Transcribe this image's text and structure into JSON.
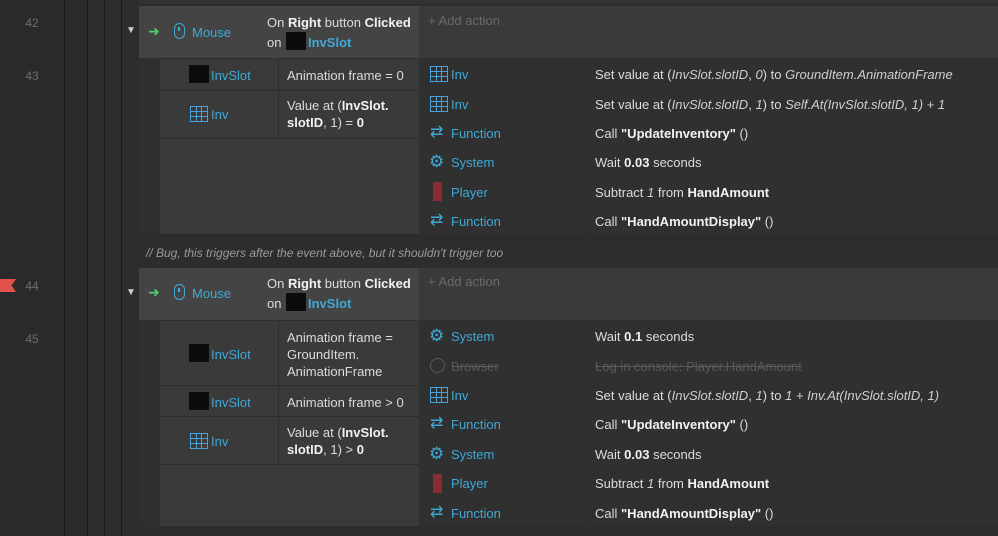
{
  "line_numbers": [
    "42",
    "43",
    "44",
    "45"
  ],
  "add_action": "+ Add action",
  "comment": "//  Bug, this triggers after the event above, but it shouldn't trigger too",
  "event1": {
    "trigger_object": "Mouse",
    "trigger_text": [
      "On ",
      "Right",
      " button ",
      "Clicked"
    ],
    "trigger_on": "on ",
    "trigger_target": "InvSlot",
    "conditions": [
      {
        "object": "InvSlot",
        "text": "Animation frame = 0"
      },
      {
        "object": "Inv",
        "text_plain": "Value at (",
        "text_bold1": "InvSlot.",
        "text_bold2": "slotID",
        "text_tail": ", 1) = ",
        "text_bold3": "0"
      }
    ],
    "actions": [
      {
        "object": "Inv",
        "icon": "grid-icon",
        "text": "Set value at (InvSlot.slotID, 0) to GroundItem.AnimationFrame"
      },
      {
        "object": "Inv",
        "icon": "grid-icon",
        "text": "Set value at (InvSlot.slotID, 1) to Self.At(InvSlot.slotID, 1) + 1"
      },
      {
        "object": "Function",
        "icon": "function-icon",
        "pre": "Call ",
        "bold": "\"UpdateInventory\"",
        "post": " ()"
      },
      {
        "object": "System",
        "icon": "gear-icon",
        "pre": "Wait ",
        "bold": "0.03",
        "post": " seconds"
      },
      {
        "object": "Player",
        "icon": "player-icon",
        "pre": "Subtract ",
        "ital": "1",
        "mid": " from ",
        "bold": "HandAmount"
      },
      {
        "object": "Function",
        "icon": "function-icon",
        "pre": "Call ",
        "bold": "\"HandAmountDisplay\"",
        "post": " ()"
      }
    ]
  },
  "event2": {
    "trigger_object": "Mouse",
    "trigger_text": [
      "On ",
      "Right",
      " button ",
      "Clicked"
    ],
    "trigger_on": "on ",
    "trigger_target": "InvSlot",
    "conditions": [
      {
        "object": "InvSlot",
        "line1": "Animation frame =",
        "line2": "GroundItem.",
        "line3": "AnimationFrame"
      },
      {
        "object": "InvSlot",
        "text": "Animation frame > 0"
      },
      {
        "object": "Inv",
        "text_plain": "Value at (",
        "text_bold1": "InvSlot.",
        "text_bold2": "slotID",
        "text_tail": ", 1) > ",
        "text_bold3": "0"
      }
    ],
    "actions": [
      {
        "object": "System",
        "pre": "Wait ",
        "bold": "0.1",
        "post": " seconds"
      },
      {
        "object": "Browser",
        "text": "Log in console: Player.HandAmount",
        "disabled": "true"
      },
      {
        "object": "Inv",
        "text": "Set value at (InvSlot.slotID, 1) to 1 + Inv.At(InvSlot.slotID, 1)"
      },
      {
        "object": "Function",
        "pre": "Call ",
        "bold": "\"UpdateInventory\"",
        "post": " ()"
      },
      {
        "object": "System",
        "pre": "Wait ",
        "bold": "0.03",
        "post": " seconds"
      },
      {
        "object": "Player",
        "pre": "Subtract ",
        "ital": "1",
        "mid": " from ",
        "bold": "HandAmount"
      },
      {
        "object": "Function",
        "pre": "Call ",
        "bold": "\"HandAmountDisplay\"",
        "post": " ()"
      }
    ]
  },
  "colors": {
    "accent": "#3fa9d6",
    "trigger_arrow": "#4bd16d",
    "breakpoint": "#e0524b",
    "player": "#8b2b33"
  }
}
